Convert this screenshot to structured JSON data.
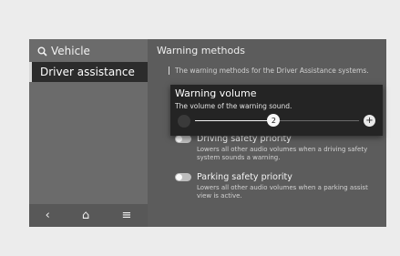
{
  "sidebar": {
    "search_label": "Vehicle",
    "items": [
      {
        "label": "Driver assistance"
      }
    ],
    "nav": {
      "back": "‹",
      "home": "⌂",
      "menu": "≡"
    }
  },
  "content": {
    "section_title": "Warning methods",
    "intro": "The warning methods for the Driver Assistance systems.",
    "settings": [
      {
        "label": "Driving safety priority",
        "description": "Lowers all other audio volumes when a driving safety system sounds a warning."
      },
      {
        "label": "Parking safety priority",
        "description": "Lowers all other audio volumes when a parking assist view is active."
      }
    ]
  },
  "popup": {
    "title": "Warning volume",
    "description": "The volume of the warning sound.",
    "slider": {
      "value": "2",
      "fraction": 0.48,
      "plus": "+"
    }
  }
}
